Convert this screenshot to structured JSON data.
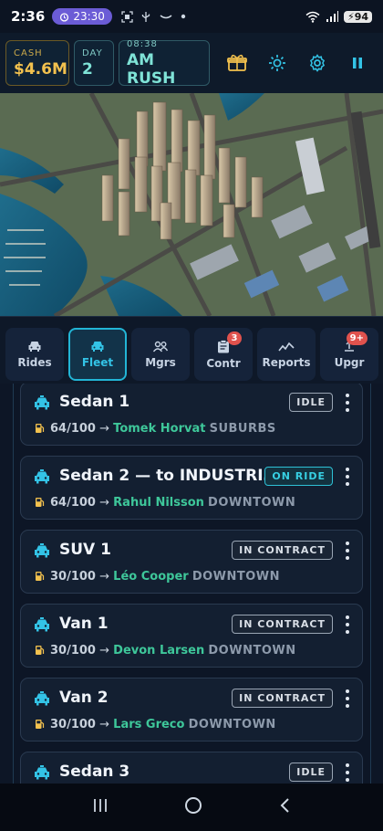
{
  "status": {
    "time": "2:36",
    "alarm": "23:30",
    "battery": "94"
  },
  "hud": {
    "cash_label": "CASH",
    "cash_value": "$4.6M",
    "day_label": "DAY",
    "day_value": "2",
    "clock_label": "08:38",
    "phase_value": "AM RUSH",
    "icons": [
      "gift-icon",
      "sun-icon",
      "gear-icon",
      "pause-icon"
    ]
  },
  "tabs": [
    {
      "label": "Rides",
      "icon": "car-icon",
      "badge": ""
    },
    {
      "label": "Fleet",
      "icon": "car-icon",
      "badge": "",
      "active": true
    },
    {
      "label": "Mgrs",
      "icon": "people-icon",
      "badge": ""
    },
    {
      "label": "Contr",
      "icon": "clipboard-icon",
      "badge": "3"
    },
    {
      "label": "Reports",
      "icon": "chart-icon",
      "badge": ""
    },
    {
      "label": "Upgr",
      "icon": "upgrade-icon",
      "badge": "9+"
    }
  ],
  "fleet": [
    {
      "name": "Sedan 1",
      "status": "IDLE",
      "fuel": "64/100",
      "driver": "Tomek Horvat",
      "zone": "SUBURBS"
    },
    {
      "name": "Sedan 2  —  to INDUSTRI…",
      "status": "ON RIDE",
      "fuel": "64/100",
      "driver": "Rahul Nilsson",
      "zone": "DOWNTOWN"
    },
    {
      "name": "SUV 1",
      "status": "IN CONTRACT",
      "fuel": "30/100",
      "driver": "Léo Cooper",
      "zone": "DOWNTOWN"
    },
    {
      "name": "Van 1",
      "status": "IN CONTRACT",
      "fuel": "30/100",
      "driver": "Devon Larsen",
      "zone": "DOWNTOWN"
    },
    {
      "name": "Van 2",
      "status": "IN CONTRACT",
      "fuel": "30/100",
      "driver": "Lars Greco",
      "zone": "DOWNTOWN"
    },
    {
      "name": "Sedan 3",
      "status": "IDLE",
      "fuel": "",
      "driver": "",
      "zone": ""
    }
  ],
  "arrow": "→",
  "colors": {
    "accent": "#22b5d6",
    "gold": "#f2c14e",
    "driver_green": "#3ec79a",
    "badge_red": "#e0524d"
  }
}
